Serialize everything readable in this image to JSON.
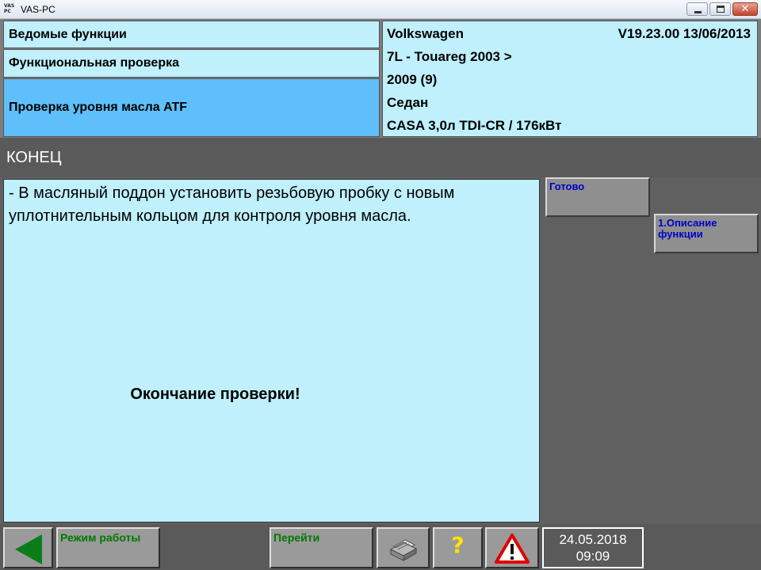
{
  "window": {
    "app_icon_top": "VAS",
    "app_icon_bottom": "PC",
    "title": "VAS-PC",
    "close_glyph": "✕"
  },
  "breadcrumb": [
    {
      "label": "Ведомые функции"
    },
    {
      "label": "Функциональная проверка"
    },
    {
      "label": "Проверка уровня масла ATF"
    }
  ],
  "vehicle": {
    "make": "Volkswagen",
    "version": "V19.23.00 13/06/2013",
    "model": "7L - Touareg 2003 >",
    "year": "2009 (9)",
    "body": "Седан",
    "engine": "CASA 3,0л TDI-CR / 176кВт"
  },
  "status": {
    "text": "КОНЕЦ"
  },
  "main": {
    "instruction": "- В масляный поддон установить резьбовую пробку с новым уплотнительным кольцом для контроля уровня масла.",
    "end_message": "Окончание проверки!"
  },
  "side_buttons": {
    "ready": "Готово",
    "description": "1.Описание функции"
  },
  "toolbar": {
    "back_icon": "back-arrow-icon",
    "mode_label": "Режим работы",
    "goto_label": "Перейти",
    "print_icon": "printer-icon",
    "help_glyph": "?",
    "warning_icon": "warning-triangle-icon",
    "date": "24.05.2018",
    "time": "09:09"
  },
  "colors": {
    "panel_light": "#bff0fc",
    "panel_selected": "#5fbffb",
    "background_dark": "#5a5a5a",
    "button_grey": "#9a9a9a",
    "link_blue": "#0000cc",
    "mode_green": "#007a00",
    "help_yellow": "#ffe400",
    "warning_red": "#e00000"
  }
}
